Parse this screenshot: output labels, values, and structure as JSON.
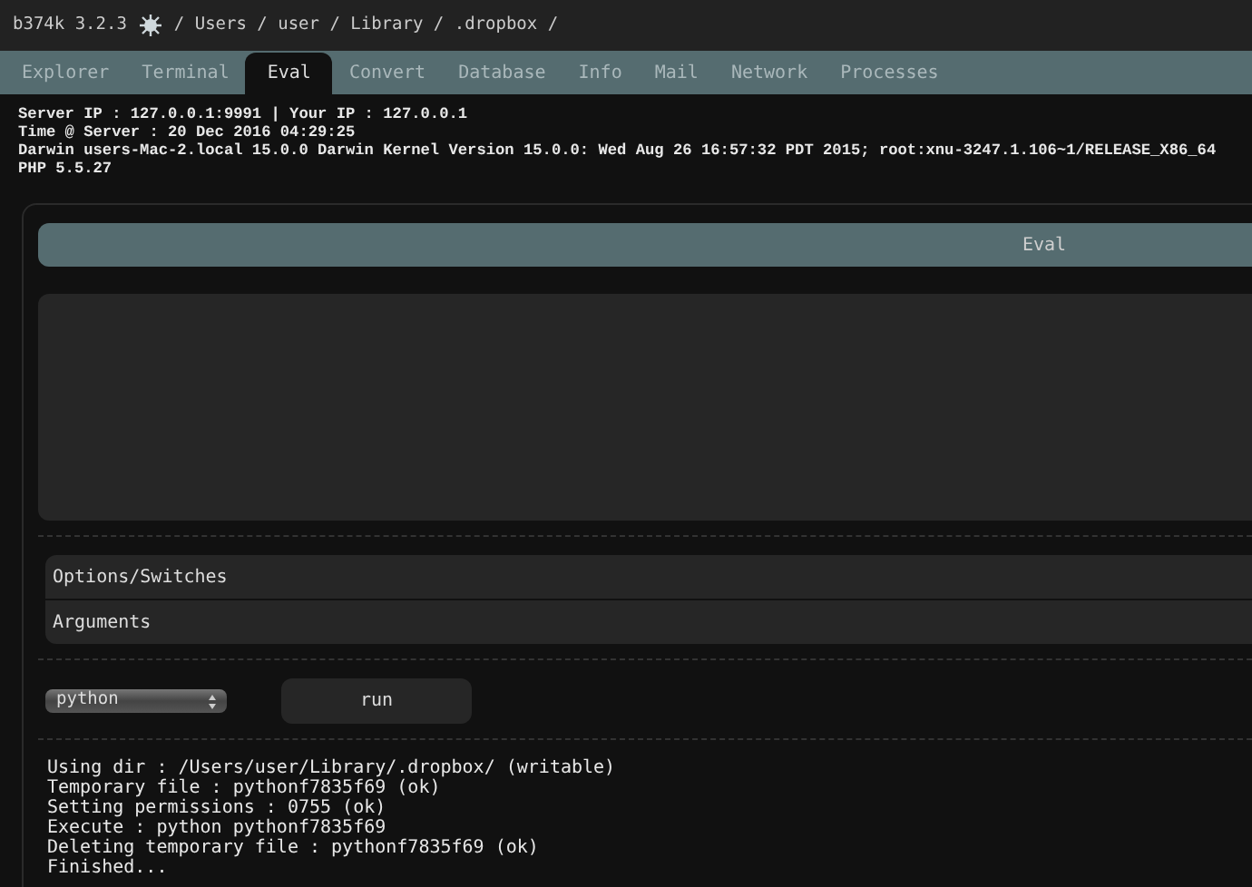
{
  "header": {
    "version": "b374k 3.2.3",
    "path": "/ Users / user / Library / .dropbox /"
  },
  "tabs": [
    {
      "label": "Explorer",
      "selected": false
    },
    {
      "label": "Terminal",
      "selected": false
    },
    {
      "label": "Eval",
      "selected": true
    },
    {
      "label": "Convert",
      "selected": false
    },
    {
      "label": "Database",
      "selected": false
    },
    {
      "label": "Info",
      "selected": false
    },
    {
      "label": "Mail",
      "selected": false
    },
    {
      "label": "Network",
      "selected": false
    },
    {
      "label": "Processes",
      "selected": false
    }
  ],
  "info": [
    "Server IP : 127.0.0.1:9991 | Your IP : 127.0.0.1",
    "Time @ Server : 20 Dec 2016 04:29:25",
    "Darwin users-Mac-2.local 15.0.0 Darwin Kernel Version 15.0.0: Wed Aug 26 16:57:32 PDT 2015; root:xnu-3247.1.106~1/RELEASE_X86_64",
    "PHP 5.5.27"
  ],
  "eval": {
    "title": "Eval",
    "options_placeholder": "Options/Switches",
    "arguments_placeholder": "Arguments",
    "language": "python",
    "run_button": "run",
    "output": [
      "Using dir : /Users/user/Library/.dropbox/ (writable)",
      "Temporary file : pythonf7835f69 (ok)",
      "Setting permissions : 0755 (ok)",
      "Execute : python pythonf7835f69",
      "Deleting temporary file : pythonf7835f69 (ok)",
      "Finished..."
    ]
  }
}
